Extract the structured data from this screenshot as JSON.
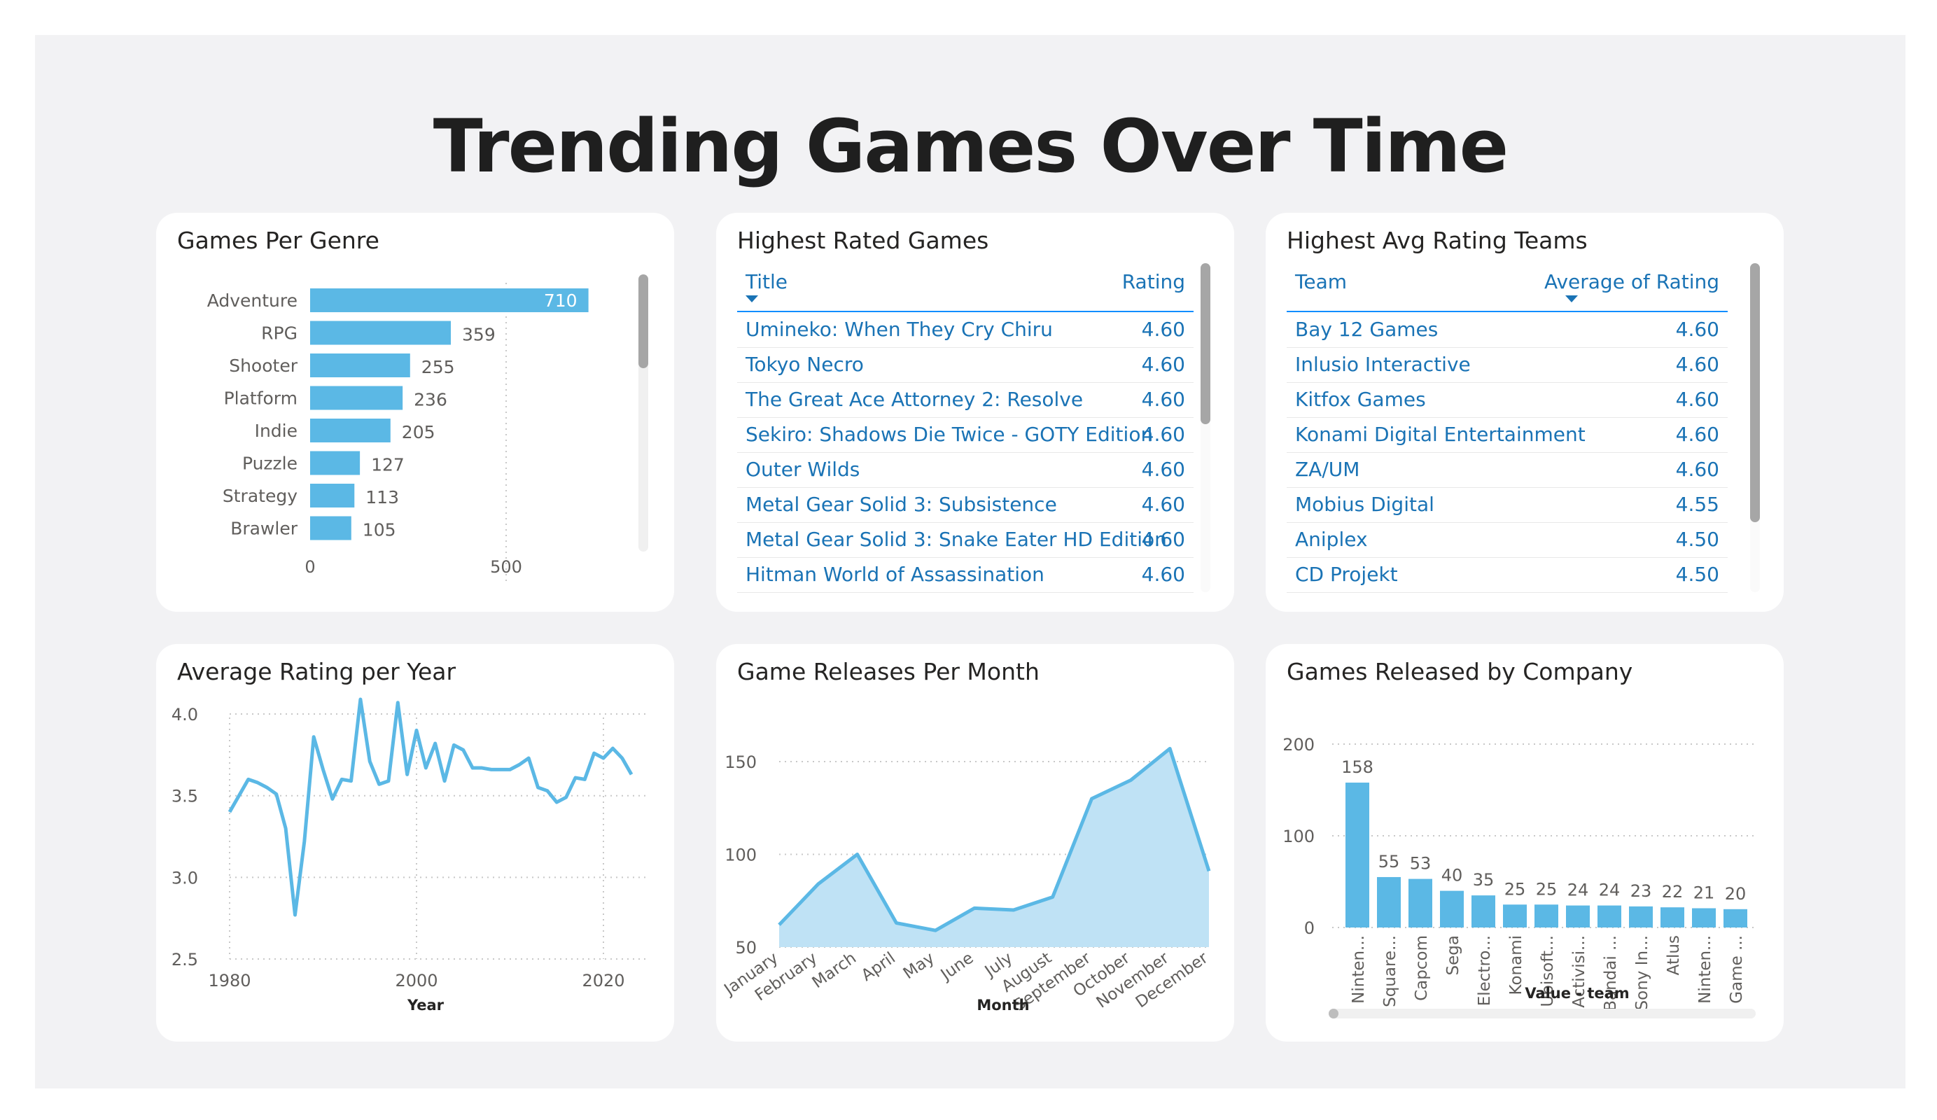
{
  "page_title": "Trending Games Over Time",
  "colors": {
    "accent": "#5bb8e5",
    "area_fill": "#bfe2f5",
    "header_text": "#1a73b5",
    "card_bg": "#ffffff",
    "page_bg": "#f2f2f4"
  },
  "genre_card": {
    "title": "Games Per Genre"
  },
  "rated_card": {
    "title": "Highest Rated Games"
  },
  "teams_card": {
    "title": "Highest Avg Rating Teams"
  },
  "year_card": {
    "title": "Average Rating per Year"
  },
  "month_card": {
    "title": "Game Releases Per Month"
  },
  "company_card": {
    "title": "Games Released by Company"
  },
  "top_games_table": {
    "columns": [
      "Title",
      "Rating"
    ],
    "rows": [
      [
        "Umineko: When They Cry Chiru",
        "4.60"
      ],
      [
        "Tokyo Necro",
        "4.60"
      ],
      [
        "The Great Ace Attorney 2: Resolve",
        "4.60"
      ],
      [
        "Sekiro: Shadows Die Twice - GOTY Edition",
        "4.60"
      ],
      [
        "Outer Wilds",
        "4.60"
      ],
      [
        "Metal Gear Solid 3: Subsistence",
        "4.60"
      ],
      [
        "Metal Gear Solid 3: Snake Eater HD Edition",
        "4.60"
      ],
      [
        "Hitman World of Assassination",
        "4.60"
      ]
    ]
  },
  "top_teams_table": {
    "columns": [
      "Team",
      "Average of Rating"
    ],
    "rows": [
      [
        "Bay 12 Games",
        "4.60"
      ],
      [
        "Inlusio Interactive",
        "4.60"
      ],
      [
        "Kitfox Games",
        "4.60"
      ],
      [
        "Konami Digital Entertainment",
        "4.60"
      ],
      [
        "ZA/UM",
        "4.60"
      ],
      [
        "Mobius Digital",
        "4.55"
      ],
      [
        "Aniplex",
        "4.50"
      ],
      [
        "CD Projekt",
        "4.50"
      ]
    ]
  },
  "chart_data": [
    {
      "type": "bar",
      "orientation": "horizontal",
      "title": "Games Per Genre",
      "categories": [
        "Adventure",
        "RPG",
        "Shooter",
        "Platform",
        "Indie",
        "Puzzle",
        "Strategy",
        "Brawler"
      ],
      "values": [
        710,
        359,
        255,
        236,
        205,
        127,
        113,
        105
      ],
      "xticks": [
        0,
        500
      ],
      "xlim": [
        0,
        850
      ]
    },
    {
      "type": "line",
      "title": "Average Rating per Year",
      "xlabel": "Year",
      "x": [
        1980,
        1981,
        1982,
        1983,
        1984,
        1985,
        1986,
        1987,
        1988,
        1989,
        1990,
        1991,
        1992,
        1993,
        1994,
        1995,
        1996,
        1997,
        1998,
        1999,
        2000,
        2001,
        2002,
        2003,
        2004,
        2005,
        2006,
        2007,
        2008,
        2009,
        2010,
        2011,
        2012,
        2013,
        2014,
        2015,
        2016,
        2017,
        2018,
        2019,
        2020,
        2021,
        2022,
        2023
      ],
      "y": [
        3.4,
        3.5,
        3.6,
        3.58,
        3.55,
        3.51,
        3.3,
        2.77,
        3.22,
        3.86,
        3.66,
        3.48,
        3.6,
        3.59,
        4.09,
        3.71,
        3.57,
        3.59,
        4.07,
        3.63,
        3.9,
        3.67,
        3.82,
        3.59,
        3.81,
        3.78,
        3.67,
        3.67,
        3.66,
        3.66,
        3.66,
        3.69,
        3.73,
        3.55,
        3.53,
        3.46,
        3.49,
        3.61,
        3.6,
        3.76,
        3.73,
        3.79,
        3.73,
        3.63,
        3.49
      ],
      "ylim": [
        2.5,
        4.1
      ],
      "yticks": [
        2.5,
        3.0,
        3.5,
        4.0
      ],
      "xticks": [
        1980,
        2000,
        2020
      ]
    },
    {
      "type": "area",
      "title": "Game Releases Per Month",
      "xlabel": "Month",
      "categories": [
        "January",
        "February",
        "March",
        "April",
        "May",
        "June",
        "July",
        "August",
        "September",
        "October",
        "November",
        "December"
      ],
      "values": [
        62,
        84,
        100,
        63,
        59,
        71,
        70,
        77,
        130,
        140,
        157,
        91
      ],
      "ylim": [
        50,
        160
      ],
      "yticks": [
        50,
        100,
        150
      ]
    },
    {
      "type": "bar",
      "title": "Games Released by Company",
      "xlabel": "Value - team",
      "categories": [
        "Ninten...",
        "Square...",
        "Capcom",
        "Sega",
        "Electro...",
        "Konami",
        "Ubisoft...",
        "Activisi...",
        "Bandai ...",
        "Sony In...",
        "Atlus",
        "Ninten...",
        "Game ..."
      ],
      "values": [
        158,
        55,
        53,
        40,
        35,
        25,
        25,
        24,
        24,
        23,
        22,
        21,
        20
      ],
      "ylim": [
        0,
        200
      ],
      "yticks": [
        0,
        100,
        200
      ]
    }
  ]
}
